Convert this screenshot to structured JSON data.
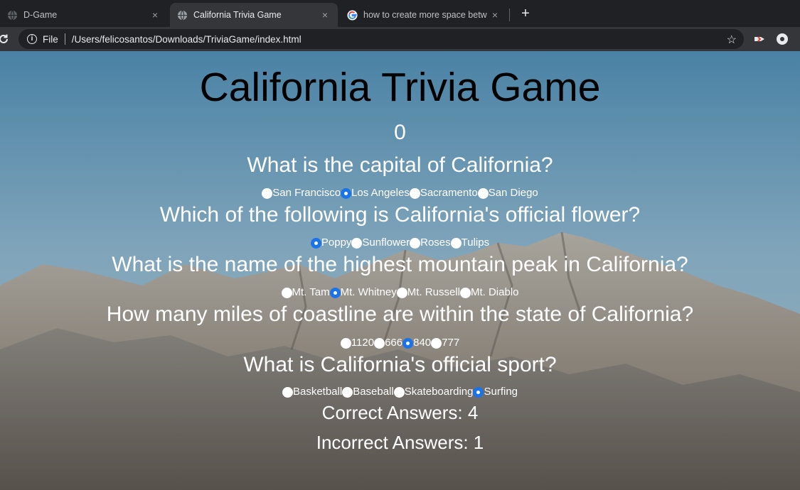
{
  "browser": {
    "tabs": [
      {
        "title": "D-Game"
      },
      {
        "title": "California Trivia Game"
      },
      {
        "title": "how to create more space betw"
      }
    ],
    "new_tab": "+",
    "close_glyph": "×",
    "scheme": "File",
    "url": "/Users/felicosantos/Downloads/TriviaGame/index.html"
  },
  "game": {
    "title": "California Trivia Game",
    "score": "0",
    "questions": [
      {
        "text": "What is the capital of California?",
        "options": [
          "San Francisco",
          "Los Angeles",
          "Sacramento",
          "San Diego"
        ],
        "selected": 1
      },
      {
        "text": "Which of the following is California's official flower?",
        "options": [
          "Poppy",
          "Sunflower",
          "Roses",
          "Tulips"
        ],
        "selected": 0
      },
      {
        "text": "What is the name of the highest mountain peak in California?",
        "options": [
          "Mt. Tam",
          "Mt. Whitney",
          "Mt. Russell",
          "Mt. Diablo"
        ],
        "selected": 1
      },
      {
        "text": "How many miles of coastline are within the state of California?",
        "options": [
          "1120",
          "666",
          "840",
          "777"
        ],
        "selected": 2
      },
      {
        "text": "What is California's official sport?",
        "options": [
          "Basketball",
          "Baseball",
          "Skateboarding",
          "Surfing"
        ],
        "selected": 3
      }
    ],
    "correct": "Correct Answers: 4",
    "incorrect": "Incorrect Answers: 1"
  },
  "colors": {
    "radio_selected": "#1a73e8",
    "title_text": "#000000",
    "body_text": "#ffffff"
  },
  "icons": [
    "globe-icon",
    "google-icon",
    "close-icon",
    "reload-icon",
    "info-icon",
    "star-icon"
  ]
}
